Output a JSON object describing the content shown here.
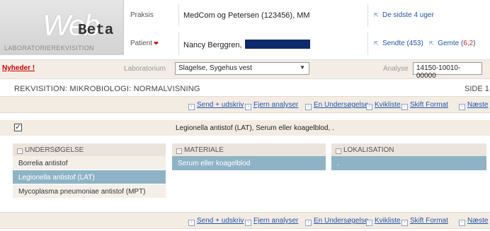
{
  "logo": {
    "web": "Web",
    "beta": "Beta",
    "subtitle": "LABORATORIEREKVISITION"
  },
  "header": {
    "praksis_label": "Praksis",
    "praksis_value": "MedCom og Petersen (123456), MM",
    "period_link": "De sidste 4 uger",
    "patient_label": "Patient",
    "patient_value": "Nancy Berggren,",
    "sent_link": "Sendte (453)",
    "saved_link_prefix": "Gemte (",
    "saved_link_count": "6,2",
    "saved_link_suffix": ")"
  },
  "labbar": {
    "news": "Nyheder !",
    "lab_label": "Laboratorium",
    "lab_value": "Slagelse, Sygehus vest",
    "analysis_label": "Analyse",
    "analysis_value": "14150-10010-00000"
  },
  "title": "REKVISITION: MIKROBIOLOGI: NORMALVISNING",
  "page": "SIDE 1",
  "toolbar": {
    "send_print": "Send + udskriv",
    "remove": "Fjern analyser",
    "one_exam": "En Undersøgelse",
    "quicklist": "Kvikliste",
    "change_format": "Skift Format",
    "next": "Næste"
  },
  "analysis": {
    "checked": "✓",
    "text": "Legionella antistof (LAT), Serum eller koagelblod, ."
  },
  "panels": {
    "undersogelse": {
      "header": "UNDERSØGELSE",
      "items": [
        "Borrelia antistof",
        "Legionella antistof (LAT)",
        "Mycoplasma pneumoniae antistof (MPT)"
      ]
    },
    "materiale": {
      "header": "MATERIALE",
      "value": "Serum eller koagelblod"
    },
    "lokalisation": {
      "header": "LOKALISATION",
      "value": "."
    }
  },
  "colors": {
    "accent": "#8fb3c6",
    "link": "#2255aa",
    "news": "#d00000",
    "patient_mask": "#0d2a6b"
  }
}
